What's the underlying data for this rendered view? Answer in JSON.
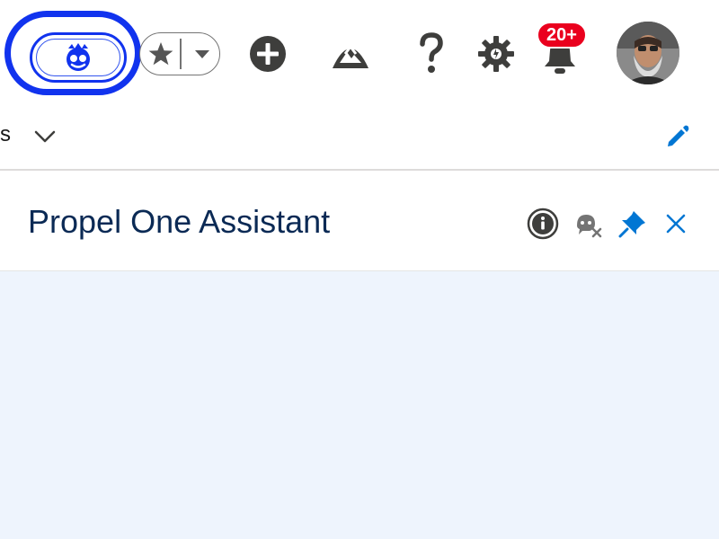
{
  "header": {
    "agent_button_icon": "agentforce-icon",
    "favorites_icon": "star-icon",
    "favorites_menu_icon": "caret-down-icon",
    "global_actions_icon": "plus-circle-icon",
    "trailhead_icon": "trailhead-icon",
    "help_icon": "question-icon",
    "setup_icon": "gear-icon",
    "notifications_icon": "bell-icon",
    "notifications_badge": "20+",
    "avatar_icon": "user-avatar",
    "focus_ring_color": "#1133ee"
  },
  "nav": {
    "tail_text": "s",
    "chevron_icon": "chevron-down-icon",
    "edit_icon": "pencil-icon",
    "accent": "#0176d3"
  },
  "panel": {
    "title": "Propel One Assistant",
    "info_icon": "info-icon",
    "hide_chat_icon": "chat-hide-icon",
    "pin_icon": "pin-icon",
    "close_icon": "close-icon",
    "body_bg": "#eef4fd"
  }
}
